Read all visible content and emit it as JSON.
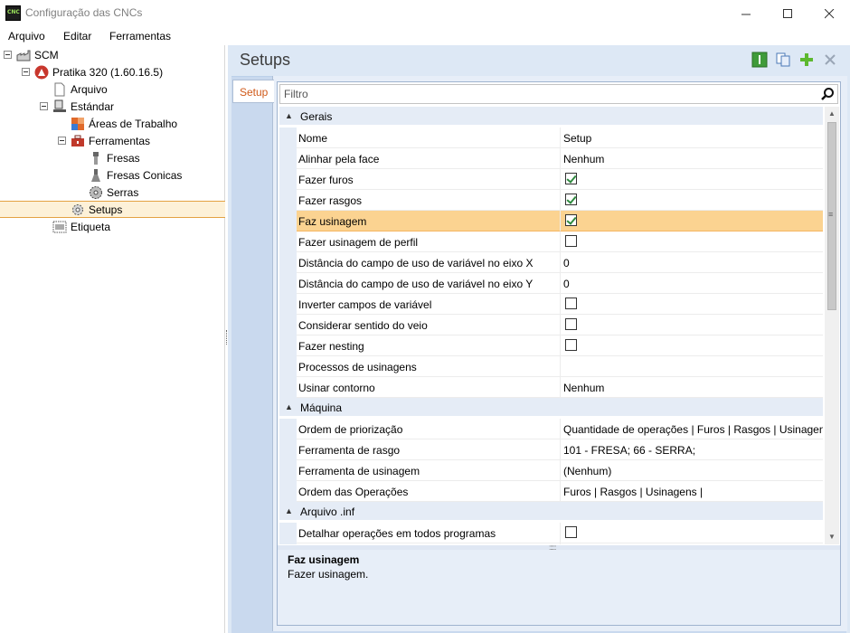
{
  "window": {
    "title": "Configuração das CNCs",
    "app_icon_label": "CNC"
  },
  "menu": {
    "items": [
      "Arquivo",
      "Editar",
      "Ferramentas"
    ]
  },
  "tree": [
    {
      "label": "SCM",
      "icon": "factory-icon",
      "level": 0,
      "expanded": true
    },
    {
      "label": "Pratika 320 (1.60.16.5)",
      "icon": "machine-logo-icon",
      "level": 1,
      "expanded": true
    },
    {
      "label": "Arquivo",
      "icon": "file-icon",
      "level": 2
    },
    {
      "label": "Estándar",
      "icon": "workstation-icon",
      "level": 2,
      "expanded": true
    },
    {
      "label": "Áreas de Trabalho",
      "icon": "work-areas-icon",
      "level": 3
    },
    {
      "label": "Ferramentas",
      "icon": "toolbox-icon",
      "level": 3,
      "expanded": true
    },
    {
      "label": "Fresas",
      "icon": "mill-bit-icon",
      "level": 4
    },
    {
      "label": "Fresas Conicas",
      "icon": "conical-bit-icon",
      "level": 4
    },
    {
      "label": "Serras",
      "icon": "saw-icon",
      "level": 4
    },
    {
      "label": "Setups",
      "icon": "gear-icon",
      "level": 3,
      "selected": true
    },
    {
      "label": "Etiqueta",
      "icon": "label-icon",
      "level": 2
    }
  ],
  "content": {
    "title": "Setups",
    "toolbar": [
      "info-icon",
      "copy-icon",
      "add-icon",
      "delete-icon"
    ],
    "tab": "Setup",
    "filter_placeholder": "Filtro"
  },
  "grid": {
    "categories": [
      {
        "name": "Gerais",
        "rows": [
          {
            "name": "Nome",
            "value": "Setup"
          },
          {
            "name": "Alinhar pela face",
            "value": "Nenhum"
          },
          {
            "name": "Fazer furos",
            "checkbox": true,
            "checked": true
          },
          {
            "name": "Fazer rasgos",
            "checkbox": true,
            "checked": true
          },
          {
            "name": "Faz usinagem",
            "checkbox": true,
            "checked": true,
            "highlighted": true
          },
          {
            "name": "Fazer usinagem de perfil",
            "checkbox": true,
            "checked": false
          },
          {
            "name": "Distância do campo de uso de variável no eixo X",
            "value": "0"
          },
          {
            "name": "Distância do campo de uso de variável no eixo Y",
            "value": "0"
          },
          {
            "name": "Inverter campos de variável",
            "checkbox": true,
            "checked": false
          },
          {
            "name": "Considerar sentido do veio",
            "checkbox": true,
            "checked": false
          },
          {
            "name": "Fazer nesting",
            "checkbox": true,
            "checked": false
          },
          {
            "name": "Processos de usinagens",
            "value": ""
          },
          {
            "name": "Usinar contorno",
            "value": "Nenhum"
          }
        ]
      },
      {
        "name": "Máquina",
        "rows": [
          {
            "name": "Ordem de priorização",
            "value": "Quantidade de operações | Furos | Rasgos | Usinagens |"
          },
          {
            "name": "Ferramenta de rasgo",
            "value": "101 - FRESA; 66 - SERRA;"
          },
          {
            "name": "Ferramenta de usinagem",
            "value": "(Nenhum)"
          },
          {
            "name": "Ordem das Operações",
            "value": "Furos | Rasgos | Usinagens |"
          }
        ]
      },
      {
        "name": "Arquivo .inf",
        "rows": [
          {
            "name": "Detalhar operações em todos programas",
            "checkbox": true,
            "checked": false
          },
          {
            "name": "",
            "value": ""
          }
        ]
      }
    ]
  },
  "description": {
    "title": "Faz usinagem",
    "text": "Fazer usinagem."
  },
  "colors": {
    "selection": "#fdf1d8",
    "row_highlight": "#fbd391",
    "accent_tab": "#d05a1a",
    "panel_bg": "#dde8f5"
  }
}
